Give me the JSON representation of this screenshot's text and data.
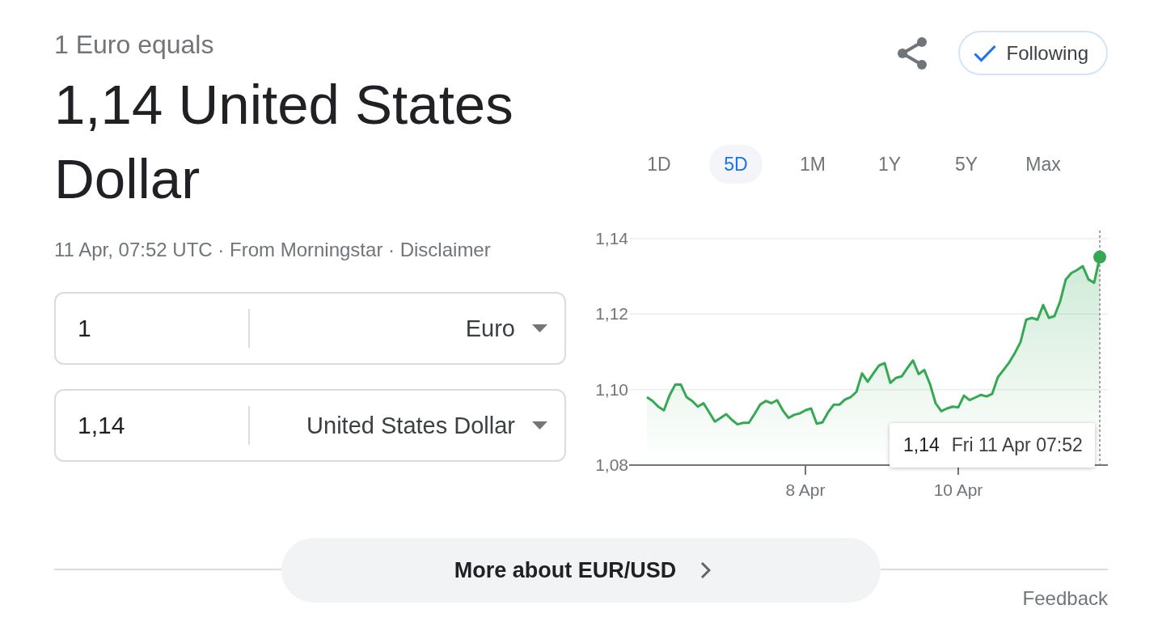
{
  "summary": {
    "caption": "1 Euro equals",
    "result": "1,14 United States Dollar",
    "source_line": "11 Apr, 07:52 UTC · From Morningstar · Disclaimer"
  },
  "actions": {
    "follow_button": {
      "label": "Following",
      "following": true
    }
  },
  "converter": [
    {
      "amount": "1",
      "currency": "Euro"
    },
    {
      "amount": "1,14",
      "currency": "United States Dollar"
    }
  ],
  "range_tabs": [
    {
      "label": "1D",
      "selected": false
    },
    {
      "label": "5D",
      "selected": true
    },
    {
      "label": "1M",
      "selected": false
    },
    {
      "label": "1Y",
      "selected": false
    },
    {
      "label": "5Y",
      "selected": false
    },
    {
      "label": "Max",
      "selected": false
    }
  ],
  "chart": {
    "chart_data": {
      "type": "area",
      "color": "#34a853",
      "categories": [
        null,
        null,
        null,
        null,
        null,
        null,
        null,
        null,
        null,
        null,
        null,
        null,
        null,
        null,
        null,
        null,
        null,
        null,
        null,
        null,
        null,
        null,
        null,
        null,
        null,
        null,
        null,
        null,
        "8 Apr",
        null,
        null,
        null,
        null,
        null,
        null,
        null,
        null,
        null,
        null,
        null,
        null,
        null,
        null,
        null,
        null,
        null,
        null,
        null,
        null,
        null,
        null,
        null,
        null,
        null,
        null,
        "10 Apr",
        null,
        null,
        null,
        null,
        null,
        null,
        null,
        null,
        null,
        null,
        null,
        null,
        null,
        null,
        null,
        null,
        null,
        null,
        null,
        null,
        null,
        null,
        null,
        null,
        null
      ],
      "values": [
        1.098,
        1.097,
        1.0955,
        1.0945,
        1.0985,
        1.1013,
        1.1013,
        1.098,
        1.097,
        1.0955,
        1.0964,
        1.094,
        1.0915,
        1.0925,
        1.0935,
        1.092,
        1.0908,
        1.0912,
        1.0912,
        1.0935,
        1.096,
        1.097,
        1.0964,
        1.0972,
        1.0945,
        1.0925,
        1.0933,
        1.0937,
        1.0945,
        1.095,
        1.091,
        1.0913,
        1.094,
        1.096,
        1.096,
        1.0974,
        1.098,
        1.0994,
        1.1043,
        1.1021,
        1.1043,
        1.1064,
        1.107,
        1.1018,
        1.1031,
        1.1035,
        1.1057,
        1.1077,
        1.1041,
        1.1052,
        1.1015,
        1.0964,
        1.0943,
        1.095,
        1.0955,
        1.0953,
        1.0984,
        1.0972,
        1.0979,
        1.0986,
        1.0982,
        1.0989,
        1.1033,
        1.1052,
        1.1072,
        1.1097,
        1.1126,
        1.1185,
        1.119,
        1.1185,
        1.1224,
        1.119,
        1.1195,
        1.1234,
        1.1292,
        1.1309,
        1.1317,
        1.1327,
        1.1292,
        1.1283,
        1.1351
      ],
      "ylim": [
        1.08,
        1.14
      ],
      "yticks": [
        {
          "value": 1.08,
          "label": "1,08"
        },
        {
          "value": 1.1,
          "label": "1,10"
        },
        {
          "value": 1.12,
          "label": "1,12"
        },
        {
          "value": 1.14,
          "label": "1,14"
        }
      ],
      "grid": true
    },
    "tooltip": {
      "value": "1,14",
      "time": "Fri 11 Apr 07:52"
    }
  },
  "more_button": {
    "label": "More about EUR/USD"
  },
  "feedback_link": "Feedback"
}
